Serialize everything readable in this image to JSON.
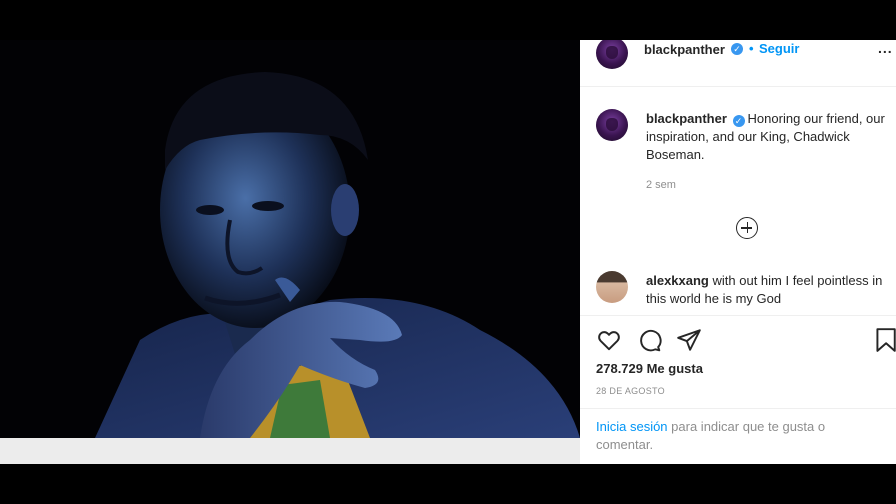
{
  "post": {
    "author": "blackpanther",
    "follow_label": "Seguir",
    "follow_separator": "•",
    "more_label": "...",
    "caption_text": "Honoring our friend, our inspiration, and our King, Chadwick Boseman.",
    "caption_age": "2 sem",
    "load_more_icon": "plus-circle-icon"
  },
  "comments": [
    {
      "author": "alexkxang",
      "text": "with out him I feel pointless in this world he is my God"
    }
  ],
  "actions": {
    "like_icon": "heart-icon",
    "comment_icon": "comment-icon",
    "share_icon": "paper-plane-icon",
    "save_icon": "bookmark-icon"
  },
  "likes_text": "278.729 Me gusta",
  "post_date": "28 DE AGOSTO",
  "login_prompt": {
    "link_text": "Inicia sesión",
    "rest_text": "para indicar que te gusta o comentar."
  },
  "colors": {
    "accent": "#0095f6",
    "verified": "#3897f0",
    "text": "#262626",
    "muted": "#8e8e8e"
  }
}
